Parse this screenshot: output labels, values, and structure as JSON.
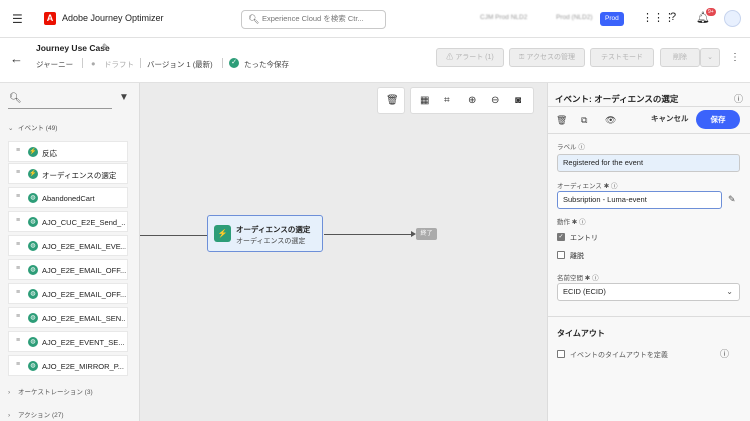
{
  "topbar": {
    "app_name": "Adobe Journey Optimizer",
    "logo_letter": "A",
    "search_placeholder": "Experience Cloud を検索 Ctr...",
    "org_1": "CJM Prod NLD2",
    "org_2": "Prod (NLD2)",
    "env_badge": "Prod",
    "notif_count": "9+"
  },
  "journey": {
    "title": "Journey Use Case",
    "type": "ジャーニー",
    "status": "ドラフト",
    "version": "バージョン 1 (最新)",
    "saved": "たった今保存",
    "buttons": {
      "alerts": "アラート (1)",
      "access": "アクセスの管理",
      "test": "テストモード",
      "delete": "削除"
    }
  },
  "left_panel": {
    "events_section": "イベント (49)",
    "orchestration_section": "オーケストレーション (3)",
    "actions_section": "アクション (27)",
    "items": [
      "反応",
      "オーディエンスの選定",
      "AbandonedCart",
      "AJO_CUC_E2E_Send_...",
      "AJO_E2E_EMAIL_EVE...",
      "AJO_E2E_EMAIL_OFF...",
      "AJO_E2E_EMAIL_OFF...",
      "AJO_E2E_EMAIL_SEN...",
      "AJO_E2E_EVENT_SE...",
      "AJO_E2E_MIRROR_P..."
    ]
  },
  "canvas": {
    "node_title": "オーディエンスの選定",
    "node_subtitle": "オーディエンスの選定",
    "end_label": "終了"
  },
  "right_panel": {
    "title": "イベント: オーディエンスの選定",
    "cancel": "キャンセル",
    "save": "保存",
    "label_caption": "ラベル",
    "label_value": "Registered for the event",
    "audience_caption": "オーディエンス",
    "audience_value": "Subsription - Luma-event",
    "behavior_caption": "動作",
    "behavior_entry": "エントリ",
    "behavior_exit": "離脱",
    "namespace_caption": "名前空間",
    "namespace_value": "ECID (ECID)",
    "timeout_title": "タイムアウト",
    "timeout_checkbox": "イベントのタイムアウトを定義"
  },
  "colors": {
    "accent": "#3b63fb",
    "event_green": "#2d9d78",
    "node_border": "#6d8fd8"
  }
}
